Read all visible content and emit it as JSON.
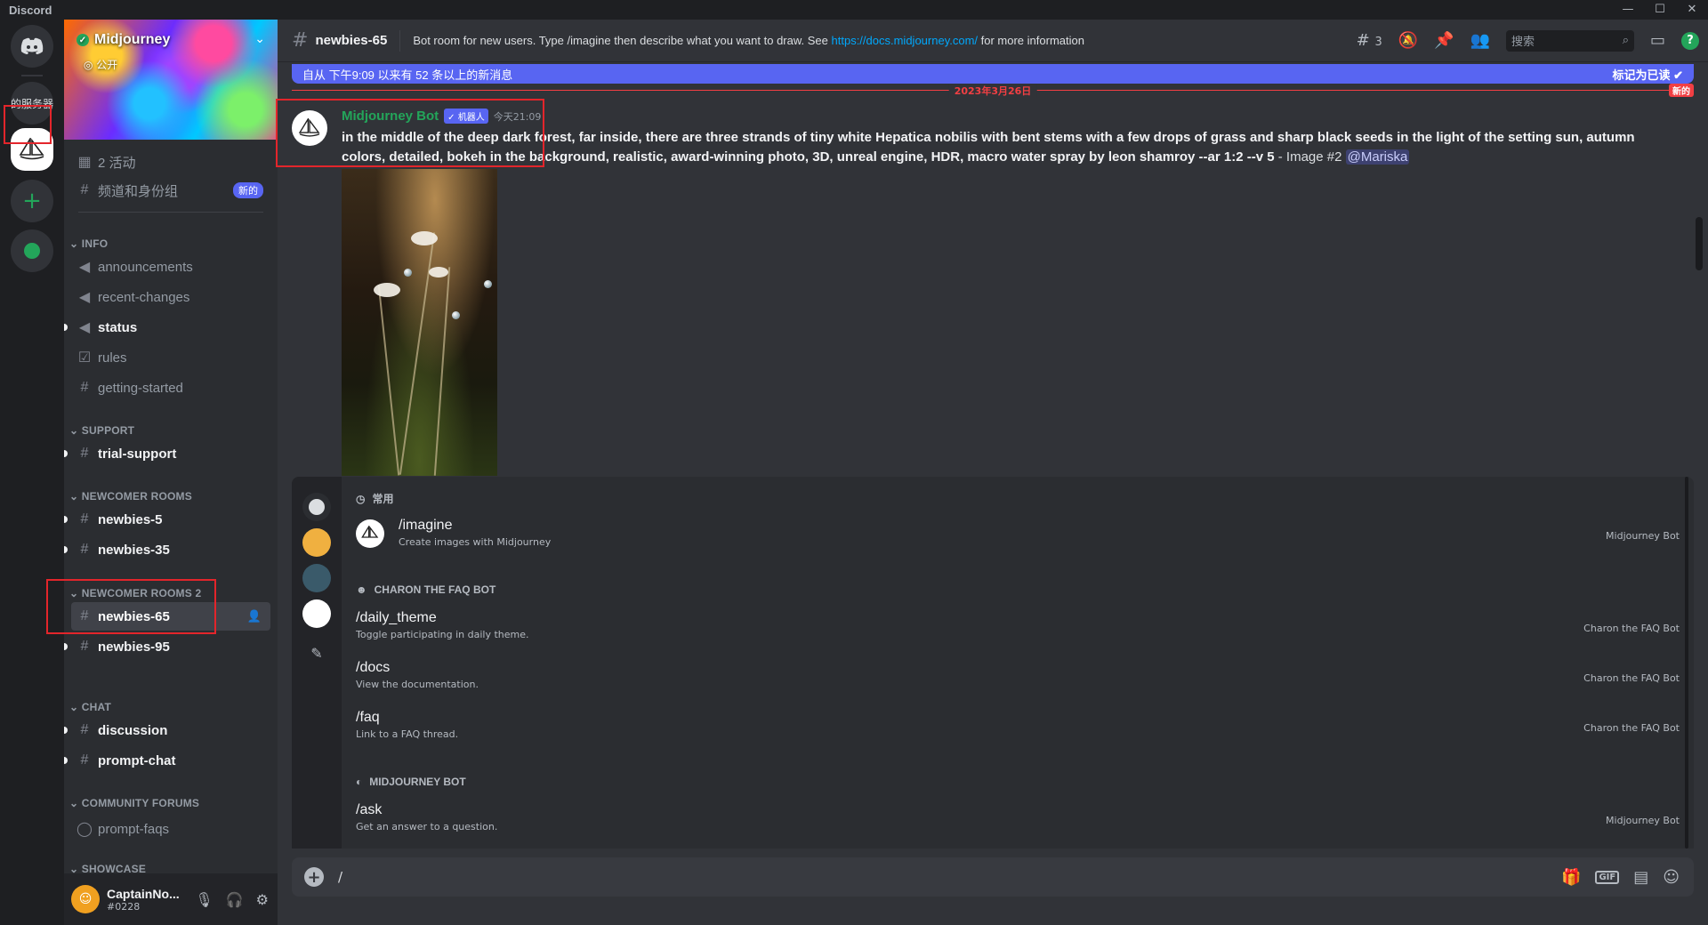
{
  "app": {
    "title": "Discord",
    "window_controls": [
      "—",
      "☐",
      "✕"
    ]
  },
  "rail": {
    "text_server": "的服务器"
  },
  "server": {
    "name": "Midjourney",
    "visibility": "公开"
  },
  "sidebar": {
    "top": [
      {
        "icon": "calendar-icon",
        "label": "2 活动"
      },
      {
        "icon": "channels-roles-icon",
        "label": "频道和身份组",
        "badge": "新的"
      }
    ],
    "categories": {
      "info": "INFO",
      "support": "SUPPORT",
      "newcomer": "NEWCOMER ROOMS",
      "newcomer2": "NEWCOMER ROOMS 2",
      "chat": "CHAT",
      "forums": "COMMUNITY FORUMS",
      "showcase": "SHOWCASE"
    },
    "channels": {
      "announcements": "announcements",
      "recent_changes": "recent-changes",
      "status": "status",
      "rules": "rules",
      "getting_started": "getting-started",
      "trial_support": "trial-support",
      "newbies_5": "newbies-5",
      "newbies_35": "newbies-35",
      "newbies_65": "newbies-65",
      "newbies_95": "newbies-95",
      "discussion": "discussion",
      "prompt_chat": "prompt-chat",
      "prompt_faqs": "prompt-faqs"
    }
  },
  "user": {
    "name": "CaptainNo...",
    "tag": "#0228"
  },
  "header": {
    "channel": "newbies-65",
    "topic": "Bot room for new users. Type /imagine then describe what you want to draw. See",
    "topic_link": "https://docs.midjourney.com/",
    "topic_tail": "for more information",
    "thread_count": "3",
    "search_placeholder": "搜索"
  },
  "new_messages_bar": {
    "text": "自从 下午9:09 以来有 52 条以上的新消息",
    "mark_read": "标记为已读"
  },
  "date_divider": {
    "date": "2023年3月26日",
    "new_label": "新的"
  },
  "message": {
    "author": "Midjourney Bot",
    "bot_tag": "✓ 机器人",
    "time": "今天21:09",
    "prompt": "in the middle of the deep dark forest, far inside, there are three strands of tiny white Hepatica nobilis with bent stems with a few drops of grass and sharp black seeds in the light of the setting sun, autumn colors, detailed, bokeh in the background, realistic, award-winning photo, 3D, unreal engine, HDR, macro water spray by leon shamroy --ar 1:2 --v 5",
    "suffix": " - Image #2 ",
    "mention": "@Mariska"
  },
  "autocomplete": {
    "section_frequent": "常用",
    "section_charon": "CHARON THE FAQ BOT",
    "section_mj": "MIDJOURNEY BOT",
    "commands": [
      {
        "name": "/imagine",
        "desc": "Create images with Midjourney",
        "source": "Midjourney Bot"
      },
      {
        "name": "/daily_theme",
        "desc": "Toggle participating in daily theme.",
        "source": "Charon the FAQ Bot"
      },
      {
        "name": "/docs",
        "desc": "View the documentation.",
        "source": "Charon the FAQ Bot"
      },
      {
        "name": "/faq",
        "desc": "Link to a FAQ thread.",
        "source": "Charon the FAQ Bot"
      },
      {
        "name": "/ask",
        "desc": "Get an answer to a question.",
        "source": "Midjourney Bot"
      }
    ]
  },
  "composer": {
    "value": "/",
    "gif_label": "GIF"
  },
  "colors": {
    "accent": "#5865f2",
    "highlight_box": "#e3252b",
    "bot_name": "#23a55a",
    "link": "#00a8fc"
  }
}
